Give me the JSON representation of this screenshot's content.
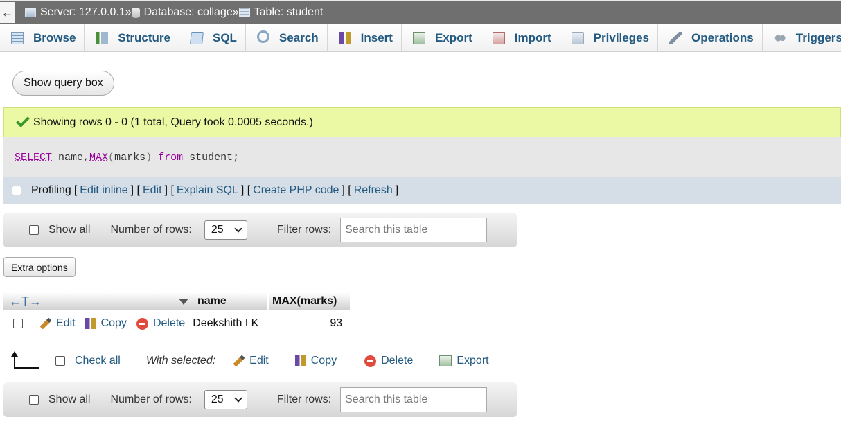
{
  "breadcrumb": {
    "back": "←",
    "server": "Server: 127.0.0.1",
    "database": "Database: collage",
    "table": "Table: student",
    "separator": "»"
  },
  "tabs": [
    {
      "label": "Browse",
      "icon": "browse-icon"
    },
    {
      "label": "Structure",
      "icon": "structure-icon"
    },
    {
      "label": "SQL",
      "icon": "sql-icon"
    },
    {
      "label": "Search",
      "icon": "search-icon"
    },
    {
      "label": "Insert",
      "icon": "insert-icon"
    },
    {
      "label": "Export",
      "icon": "export-icon"
    },
    {
      "label": "Import",
      "icon": "import-icon"
    },
    {
      "label": "Privileges",
      "icon": "privileges-icon"
    },
    {
      "label": "Operations",
      "icon": "operations-icon"
    },
    {
      "label": "Triggers",
      "icon": "triggers-icon"
    }
  ],
  "show_query_box": "Show query box",
  "message": "Showing rows 0 - 0 (1 total, Query took 0.0005 seconds.)",
  "query": {
    "select": "SELECT",
    "cols_a": " name,",
    "fn": "MAX",
    "open_paren": "(",
    "fn_arg": "marks",
    "close_paren": ")",
    "from": " from",
    "table": " student;"
  },
  "profiling": {
    "label": "Profiling",
    "links": [
      "Edit inline",
      "Edit",
      "Explain SQL",
      "Create PHP code",
      "Refresh"
    ]
  },
  "nav": {
    "show_all": "Show all",
    "rows_label": "Number of rows:",
    "rows_value": "25",
    "filter_label": "Filter rows:",
    "filter_placeholder": "Search this table"
  },
  "extra_options": "Extra options",
  "table": {
    "columns": [
      "name",
      "MAX(marks)"
    ],
    "arrows": "←T→",
    "rows": [
      {
        "edit": "Edit",
        "copy": "Copy",
        "delete": "Delete",
        "name": "Deekshith I K",
        "max_marks": "93"
      }
    ]
  },
  "with_selected": {
    "check_all": "Check all",
    "label": "With selected:",
    "edit": "Edit",
    "copy": "Copy",
    "delete": "Delete",
    "export": "Export"
  },
  "colors": {
    "link": "#235a81",
    "success_bg": "#ebf8a4",
    "keyword": "#990099"
  }
}
